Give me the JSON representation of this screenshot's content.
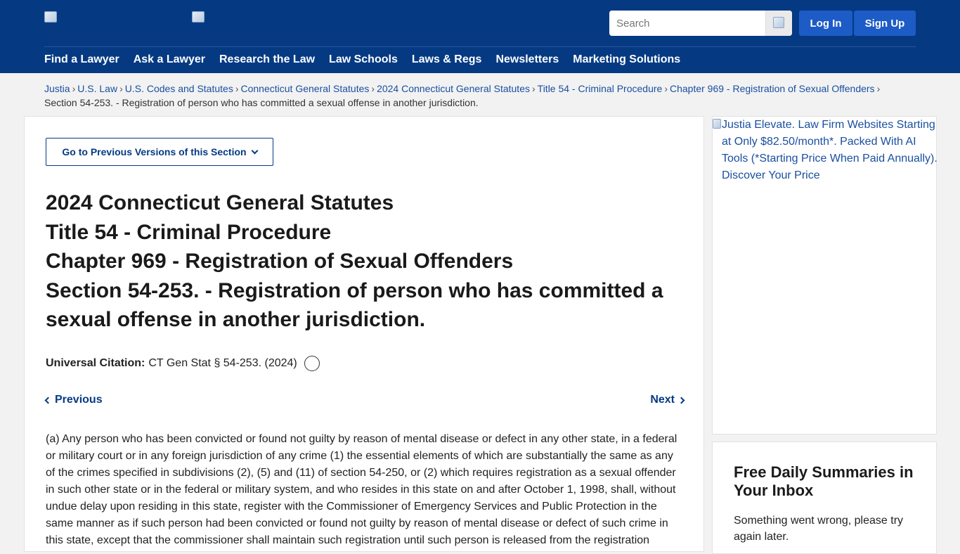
{
  "header": {
    "search_placeholder": "Search",
    "login_label": "Log In",
    "signup_label": "Sign Up",
    "nav": [
      "Find a Lawyer",
      "Ask a Lawyer",
      "Research the Law",
      "Law Schools",
      "Laws & Regs",
      "Newsletters",
      "Marketing Solutions"
    ]
  },
  "breadcrumb": {
    "links": [
      "Justia",
      "U.S. Law",
      "U.S. Codes and Statutes",
      "Connecticut General Statutes",
      "2024 Connecticut General Statutes",
      "Title 54 - Criminal Procedure",
      "Chapter 969 - Registration of Sexual Offenders"
    ],
    "separator": "›",
    "current": "Section 54-253. - Registration of person who has committed a sexual offense in another jurisdiction."
  },
  "main": {
    "prev_versions_label": "Go to Previous Versions of this Section",
    "heading": {
      "line1": "2024 Connecticut General Statutes",
      "line2": "Title 54 - Criminal Procedure",
      "line3": "Chapter 969 - Registration of Sexual Offenders",
      "line4": "Section 54-253. - Registration of person who has committed a sexual offense in another jurisdiction."
    },
    "citation_label": "Universal Citation:",
    "citation_value": "CT Gen Stat § 54-253. (2024)",
    "prev_label": "Previous",
    "next_label": "Next",
    "statute_text": "(a) Any person who has been convicted or found not guilty by reason of mental disease or defect in any other state, in a federal or military court or in any foreign jurisdiction of any crime (1) the essential elements of which are substantially the same as any of the crimes specified in subdivisions (2), (5) and (11) of section 54-250, or (2) which requires registration as a sexual offender in such other state or in the federal or military system, and who resides in this state on and after October 1, 1998, shall, without undue delay upon residing in this state, register with the Commissioner of Emergency Services and Public Protection in the same manner as if such person had been convicted or found not guilty by reason of mental disease or defect of such crime in this state, except that the commissioner shall maintain such registration until such person is released from the registration"
  },
  "sidebar": {
    "ad_alt": "Justia Elevate. Law Firm Websites Starting at Only $82.50/month*. Packed With AI Tools (*Starting Price When Paid Annually). Discover Your Price",
    "newsletter_title": "Free Daily Summaries in Your Inbox",
    "newsletter_error": "Something went wrong, please try again later."
  },
  "colors": {
    "header_bg": "#053a83",
    "button_blue": "#1d5cc6",
    "link": "#1a4fa0"
  }
}
